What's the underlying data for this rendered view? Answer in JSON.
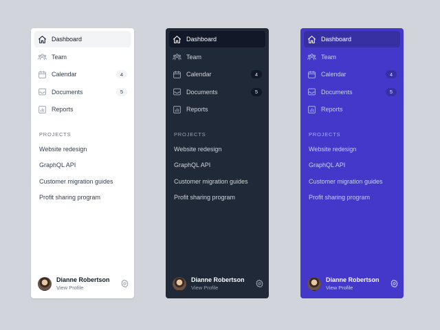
{
  "themes": [
    "light",
    "dark",
    "brand"
  ],
  "nav_items": [
    {
      "label": "Dashboard",
      "icon": "home-icon",
      "active": true,
      "count": null
    },
    {
      "label": "Team",
      "icon": "users-icon",
      "active": false,
      "count": null
    },
    {
      "label": "Calendar",
      "icon": "calendar-icon",
      "active": false,
      "count": "4"
    },
    {
      "label": "Documents",
      "icon": "inbox-icon",
      "active": false,
      "count": "5"
    },
    {
      "label": "Reports",
      "icon": "chart-bar-icon",
      "active": false,
      "count": null
    }
  ],
  "projects": {
    "heading": "PROJECTS",
    "items": [
      "Website redesign",
      "GraphQL API",
      "Customer migration guides",
      "Profit sharing program"
    ]
  },
  "user": {
    "name": "Dianne Robertson",
    "link": "View Profile"
  },
  "colors": {
    "page_background": "#d1d5db",
    "light_panel": "#ffffff",
    "dark_panel": "#1f2937",
    "brand_panel": "#4338ca"
  }
}
